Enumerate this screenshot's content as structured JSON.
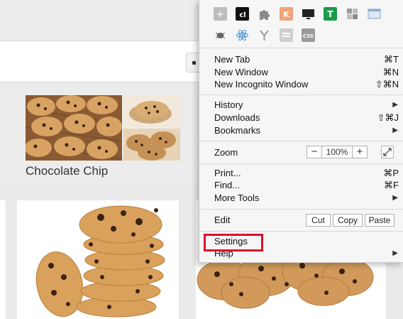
{
  "page": {
    "card_title": "Chocolate Chip"
  },
  "menu": {
    "extensions_row1": [
      "bookmark-extension-icon",
      "cl-extension-icon",
      "puzzle-icon",
      "k-extension-icon",
      "monitor-icon",
      "t-extension-icon",
      "g-extension-icon",
      "window-icon"
    ],
    "extensions_row2": [
      "bug-icon",
      "atom-icon",
      "y-extension-icon",
      "calendar-icon",
      "css-extension-icon"
    ],
    "sections": {
      "tabs": [
        {
          "label": "New Tab",
          "shortcut": "⌘T"
        },
        {
          "label": "New Window",
          "shortcut": "⌘N"
        },
        {
          "label": "New Incognito Window",
          "shortcut": "⇧⌘N"
        }
      ],
      "history": [
        {
          "label": "History",
          "shortcut": "▶"
        },
        {
          "label": "Downloads",
          "shortcut": "⇧⌘J"
        },
        {
          "label": "Bookmarks",
          "shortcut": "▶"
        }
      ],
      "zoom": {
        "label": "Zoom",
        "minus": "−",
        "value": "100%",
        "plus": "+",
        "fullscreen": "fullscreen-icon"
      },
      "tools": [
        {
          "label": "Print...",
          "shortcut": "⌘P"
        },
        {
          "label": "Find...",
          "shortcut": "⌘F"
        },
        {
          "label": "More Tools",
          "shortcut": "▶"
        }
      ],
      "edit": {
        "label": "Edit",
        "cut": "Cut",
        "copy": "Copy",
        "paste": "Paste"
      },
      "settings": [
        {
          "label": "Settings",
          "shortcut": ""
        },
        {
          "label": "Help",
          "shortcut": "▶"
        }
      ]
    }
  },
  "colors": {
    "highlight": "#e0102a",
    "menu_bg": "#f6f6f6",
    "cookie": "#c98f52"
  }
}
